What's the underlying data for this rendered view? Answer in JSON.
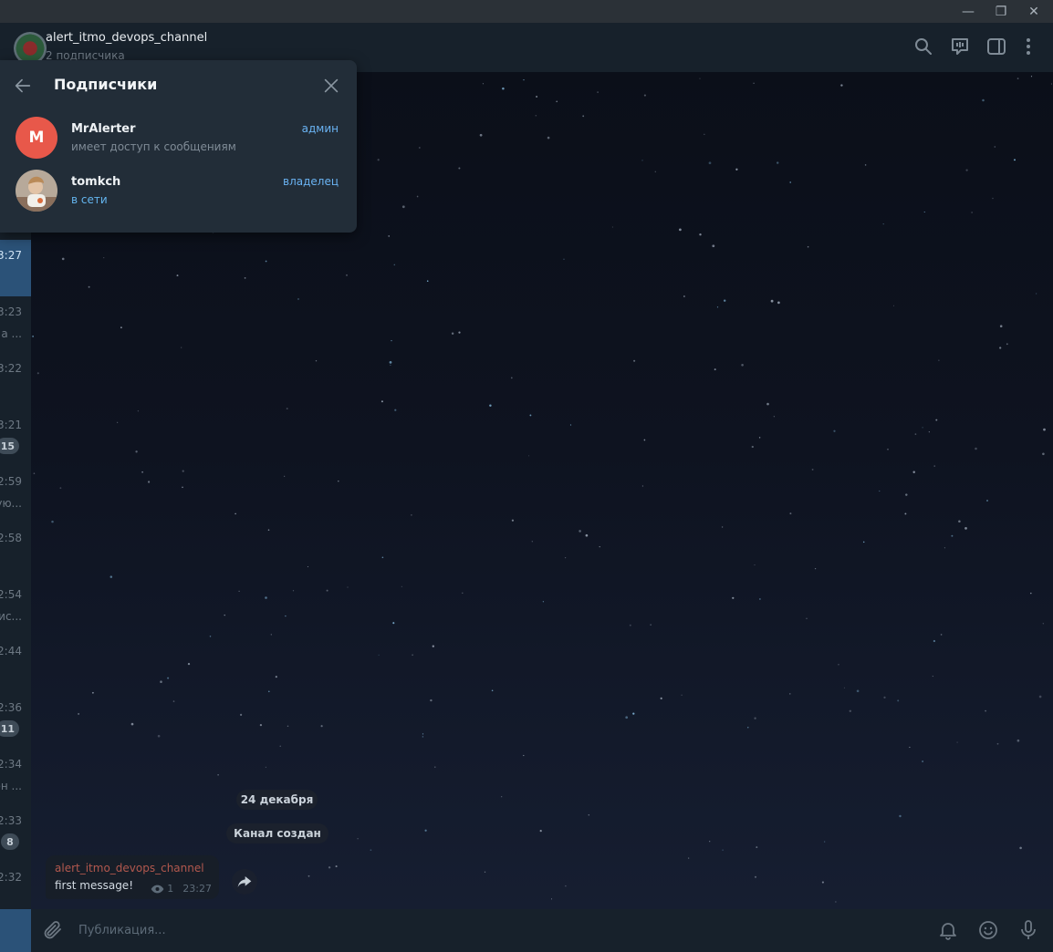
{
  "window": {
    "minimize_glyph": "—",
    "maximize_glyph": "❐",
    "close_glyph": "✕"
  },
  "chat_list": [
    {
      "time": "3:27",
      "active": true
    },
    {
      "time": "3:23",
      "preview": "а ..."
    },
    {
      "time": "3:22"
    },
    {
      "time": "3:21",
      "badge": "15"
    },
    {
      "time": "2:59",
      "preview": "ую..."
    },
    {
      "time": "2:58"
    },
    {
      "time": "2:54",
      "preview": "ис..."
    },
    {
      "time": "2:44"
    },
    {
      "time": "2:36",
      "badge": "11"
    },
    {
      "time": "2:34",
      "preview": "он ..."
    },
    {
      "time": "2:33",
      "badge": "8"
    },
    {
      "time": "2:32"
    }
  ],
  "header": {
    "title": "alert_itmo_devops_channel",
    "subtitle": "2 подписчика",
    "icons": [
      "search-icon",
      "live-stream-icon",
      "sidebar-toggle-icon",
      "more-vertical-icon"
    ]
  },
  "popup": {
    "title": "Подписчики",
    "members": [
      {
        "name": "MrAlerter",
        "initial": "M",
        "status": "имеет доступ к сообщениям",
        "role": "админ",
        "avatar_color": "#e8584a"
      },
      {
        "name": "tomkch",
        "initial": "",
        "status": "в сети",
        "role": "владелец",
        "online": true
      }
    ]
  },
  "messages": {
    "date_label": "24 декабря",
    "service_label": "Канал создан",
    "items": [
      {
        "author": "alert_itmo_devops_channel",
        "text": "first message!",
        "views": "1",
        "time": "23:27"
      }
    ]
  },
  "composer": {
    "placeholder": "Публикация..."
  },
  "colors": {
    "accent": "#6ab3f3",
    "author": "#b2584e",
    "sidebar_bg": "#17212b",
    "popup_bg": "#222d38"
  }
}
